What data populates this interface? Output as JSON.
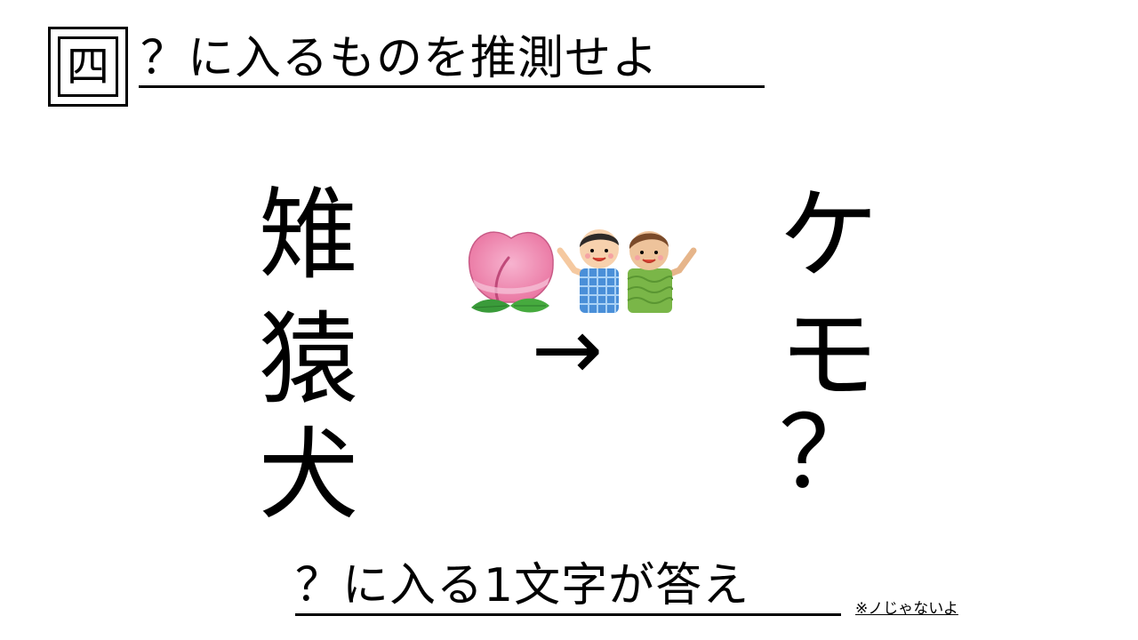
{
  "quiz": {
    "number": "四",
    "title": "？に入るものを推測せよ"
  },
  "left_column": [
    "雉",
    "猿",
    "犬"
  ],
  "arrow": "→",
  "right_column": [
    "ケ",
    "モ",
    "？"
  ],
  "pictures": {
    "peach": "peach-illustration",
    "kids": "two-boys-illustration"
  },
  "footer": {
    "answer_prompt": "？に入る1文字が答え",
    "note": "※ノじゃないよ"
  },
  "colors": {
    "peach_pink": "#ef8fb6",
    "leaf_green": "#3a9b3a",
    "shirt_blue": "#4a8fd8",
    "shirt_green": "#7ab648"
  }
}
